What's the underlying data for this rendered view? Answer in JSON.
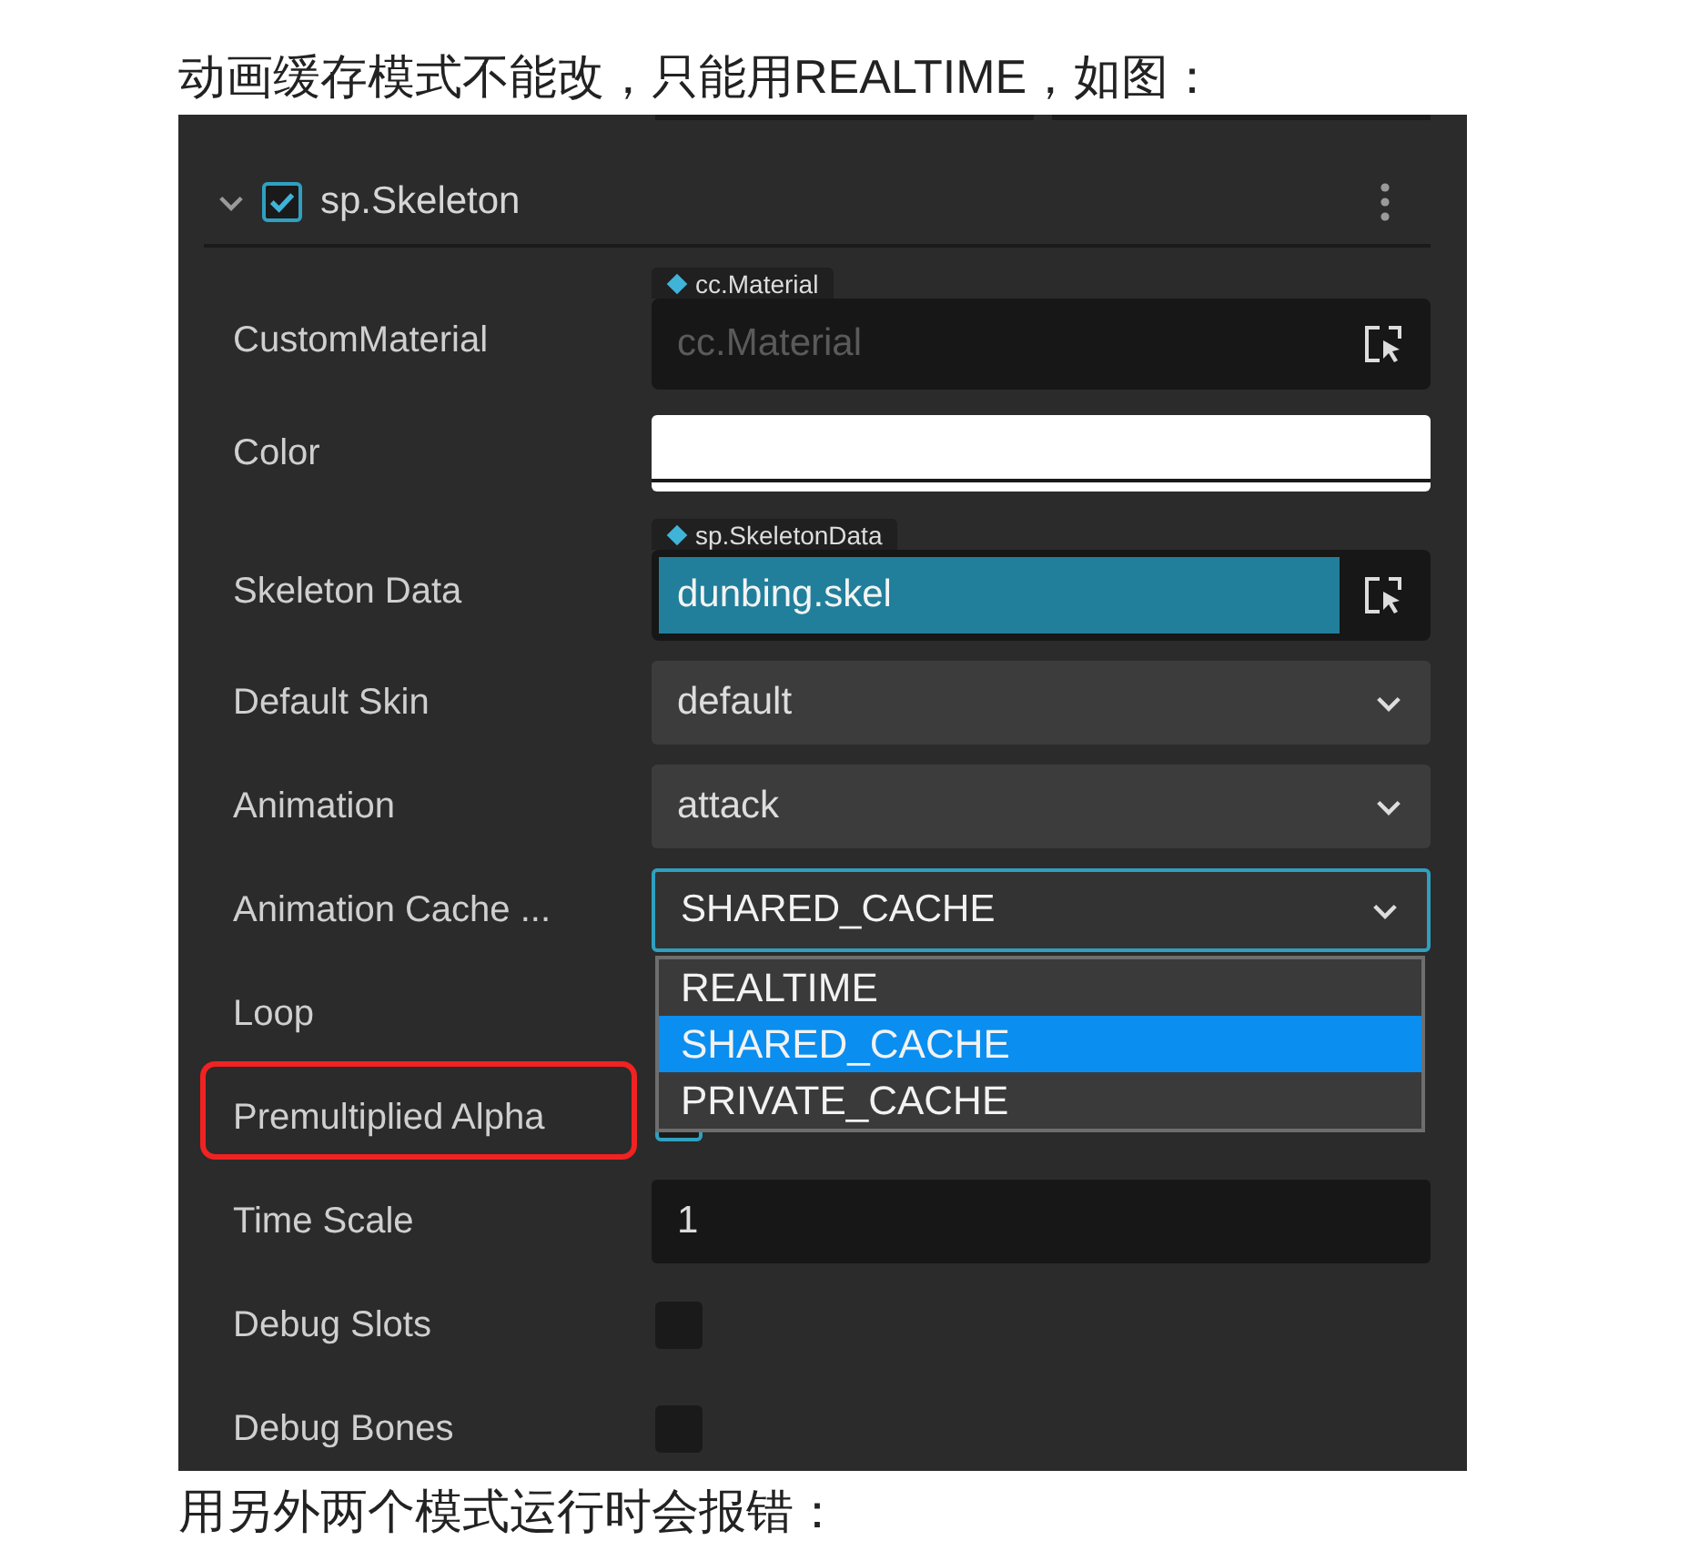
{
  "intro_text": "动画缓存模式不能改，只能用REALTIME，如图：",
  "component": {
    "title": "sp.Skeleton",
    "enabled": true,
    "expanded": true
  },
  "properties": [
    {
      "kind": "asset",
      "label": "CustomMaterial",
      "type_tag": "cc.Material",
      "placeholder": "cc.Material"
    },
    {
      "kind": "color",
      "label": "Color",
      "color": "#ffffff"
    },
    {
      "kind": "asset",
      "label": "Skeleton Data",
      "type_tag": "sp.SkeletonData",
      "value": "dunbing.skel"
    },
    {
      "kind": "select",
      "label": "Default Skin",
      "value": "default",
      "open": false
    },
    {
      "kind": "select",
      "label": "Animation",
      "value": "attack",
      "open": false
    },
    {
      "kind": "select",
      "label": "Animation Cache ...",
      "value": "SHARED_CACHE",
      "open": true,
      "options": [
        {
          "label": "REALTIME",
          "selected": false
        },
        {
          "label": "SHARED_CACHE",
          "selected": true
        },
        {
          "label": "PRIVATE_CACHE",
          "selected": false
        }
      ]
    },
    {
      "kind": "checkbox",
      "label": "Loop"
    },
    {
      "kind": "checkbox",
      "label": "Premultiplied Alpha",
      "highlighted": true,
      "checked": true
    },
    {
      "kind": "number",
      "label": "Time Scale",
      "value": "1"
    },
    {
      "kind": "checkbox",
      "label": "Debug Slots",
      "checked": false
    },
    {
      "kind": "checkbox",
      "label": "Debug Bones",
      "checked": false
    }
  ],
  "outro_text": "用另外两个模式运行时会报错："
}
